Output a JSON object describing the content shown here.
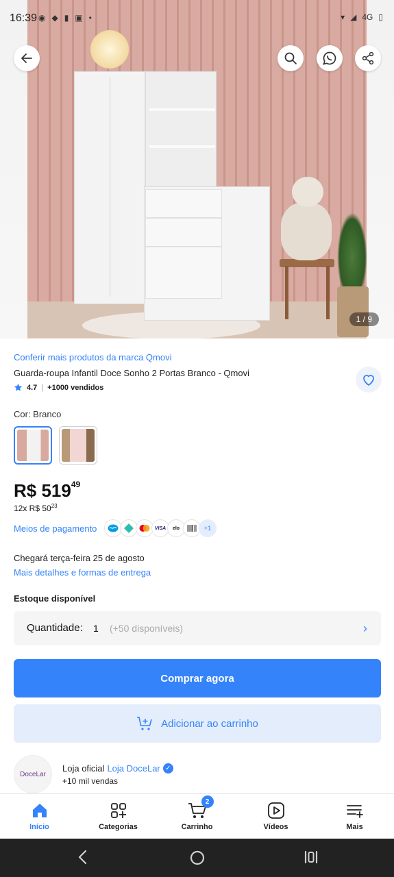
{
  "status_bar": {
    "time": "16:39",
    "network": "4G"
  },
  "gallery": {
    "counter": "1 / 9"
  },
  "product": {
    "brand_link": "Conferir mais produtos da marca Qmovi",
    "title": "Guarda-roupa Infantil Doce Sonho 2 Portas Branco - Qmovi",
    "rating": "4.7",
    "sold": "+1000 vendidos",
    "color_label": "Cor: Branco",
    "variants": [
      "Branco",
      "Rosa"
    ],
    "price_main": "R$ 519",
    "price_cents": "49",
    "installments_main": "12x R$ 50",
    "installments_cents": "23",
    "payment_link": "Meios de pagamento",
    "payment_more": "+1",
    "payment_methods": [
      "Mercado Pago",
      "Pix",
      "Mastercard",
      "VISA",
      "elo",
      "Boleto"
    ],
    "delivery_text": "Chegará terça-feira 25 de agosto",
    "delivery_link": "Mais detalhes e formas de entrega",
    "stock_label": "Estoque disponível",
    "quantity_label": "Quantidade:",
    "quantity_value": "1",
    "quantity_available": "(+50 disponíveis)"
  },
  "actions": {
    "buy_now": "Comprar agora",
    "add_to_cart": "Adicionar ao carrinho"
  },
  "store": {
    "avatar_text": "DoceLar",
    "official_label": "Loja oficial",
    "store_name": "Loja DoceLar",
    "sales": "+10 mil vendas"
  },
  "tabbar": {
    "items": [
      {
        "label": "Início",
        "icon": "home-icon",
        "active": true
      },
      {
        "label": "Categorias",
        "icon": "categories-icon",
        "active": false
      },
      {
        "label": "Carrinho",
        "icon": "cart-icon",
        "active": false,
        "badge": "2"
      },
      {
        "label": "Vídeos",
        "icon": "video-icon",
        "active": false
      },
      {
        "label": "Mais",
        "icon": "menu-icon",
        "active": false
      }
    ]
  },
  "colors": {
    "accent": "#3483fa",
    "accent_light": "#e3edfb"
  }
}
